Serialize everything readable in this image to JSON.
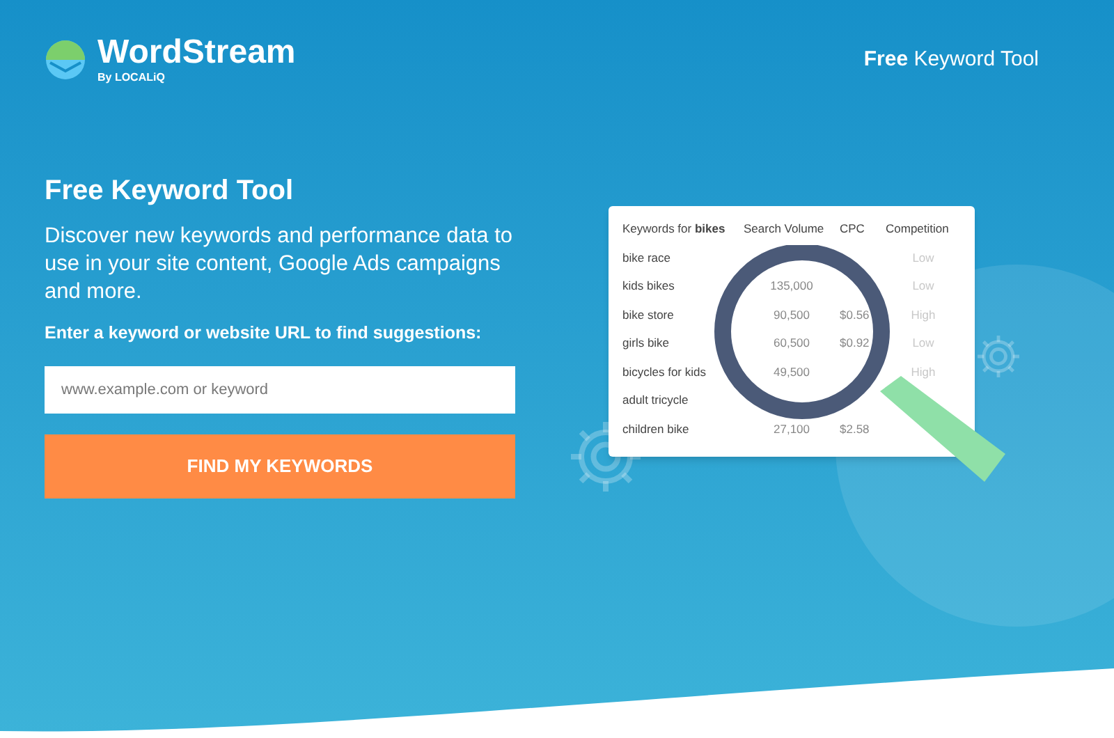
{
  "header": {
    "logo_name": "WordStream",
    "logo_byline": "By LOCALiQ",
    "nav_link": "**Free** Keyword Tool"
  },
  "hero": {
    "title": "Free Keyword Tool",
    "description": "Discover new keywords and performance data to use in your site content, Google Ads campaigns and more.",
    "field_label": "Enter a keyword or website URL to find suggestions:",
    "search": {
      "placeholder": "www.example.com or keyword"
    },
    "button": "FIND MY KEYWORDS"
  },
  "illustration": {
    "columns": [
      "Keywords for **bikes**",
      "Search Volume",
      "CPC",
      "Competition"
    ],
    "rows": [
      {
        "keyword": "bike race",
        "competition": "Low"
      },
      {
        "keyword": "kids bikes",
        "volume": "135,000",
        "competition": "Low"
      },
      {
        "keyword": "bike store",
        "volume": "90,500",
        "cpc": "$0.56",
        "competition": "High"
      },
      {
        "keyword": "girls bike",
        "volume": "60,500",
        "cpc": "$0.92",
        "competition": "Low"
      },
      {
        "keyword": "bicycles for kids",
        "volume": "49,500",
        "competition": "High"
      },
      {
        "keyword": "adult tricycle"
      },
      {
        "keyword": "children bike",
        "volume": "27,100",
        "cpc": "$2.58"
      }
    ]
  }
}
